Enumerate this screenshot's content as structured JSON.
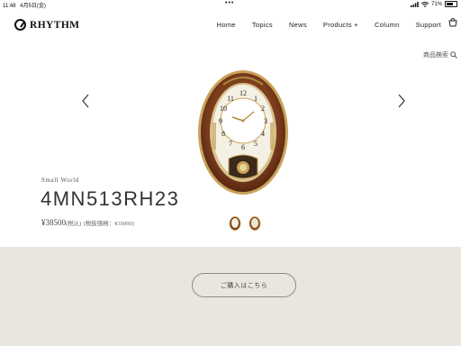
{
  "status_bar": {
    "time": "11:48",
    "date": "4月5日(金)",
    "dots": "•••",
    "battery_percent": "71%",
    "battery_level": 0.71
  },
  "header": {
    "logo_text": "RHYTHM",
    "nav": [
      "Home",
      "Topics",
      "News",
      "Products +",
      "Column",
      "Support"
    ]
  },
  "search": {
    "label": "商品検索"
  },
  "product": {
    "series": "Small World",
    "name": "4MN513RH23",
    "price": "¥38500",
    "tax_included": "(税込)",
    "price_note": "(税抜価格：¥35000)"
  },
  "buy_button": {
    "label": "ご購入はこちら"
  },
  "colors": {
    "band_background": "#eae5de",
    "clock_wood": "#7a3b1c",
    "clock_gold": "#c9a25a"
  }
}
